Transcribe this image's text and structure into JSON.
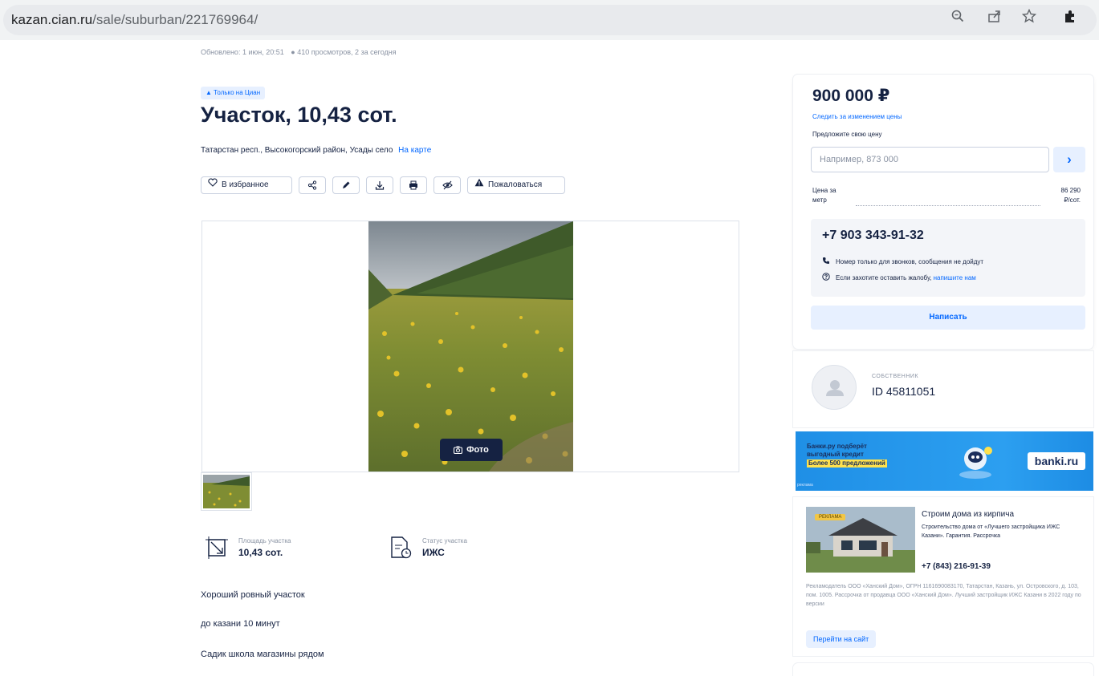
{
  "browser": {
    "url_domain": "kazan.cian.ru",
    "url_path": "/sale/suburban/221769964/",
    "icons": [
      "zoom-icon",
      "share-icon",
      "star-icon",
      "extensions-icon"
    ]
  },
  "meta": {
    "updated": "Обновлено: 1 июн, 20:51",
    "views": "410 просмотров, 2 за сегодня"
  },
  "listing": {
    "tag": "Только на Циан",
    "title": "Участок, 10,43 сот.",
    "address": "Татарстан респ., Высокогорский район, Усады село",
    "map_link": "На карте"
  },
  "actions": {
    "favorite": "В избранное",
    "complain": "Пожаловаться"
  },
  "gallery": {
    "photo_button": "Фото"
  },
  "features": [
    {
      "label": "Площадь участка",
      "value": "10,43 сот."
    },
    {
      "label": "Статус участка",
      "value": "ИЖС"
    }
  ],
  "description": [
    "Хороший ровный участок",
    "до казани 10 минут",
    "Садик школа магазины рядом"
  ],
  "price_card": {
    "price": "900 000 ₽",
    "track_link": "Следить за изменением цены",
    "offer_label": "Предложите свою цену",
    "offer_placeholder": "Например, 873 000",
    "ppm_label_1": "Цена за",
    "ppm_label_2": "метр",
    "ppm_value_1": "86 290",
    "ppm_value_2": "₽/сот.",
    "phone": "+7 903 343-91-32",
    "note_calls": "Номер только для звонков, сообщения не дойдут",
    "note_complaint": "Если захотите оставить жалобу,",
    "note_complaint_link": "напишите нам",
    "write_button": "Написать"
  },
  "owner": {
    "role": "СОБСТВЕННИК",
    "id": "ID 45811051"
  },
  "banner": {
    "line1": "Банки.ру подберёт",
    "line2": "выгодный кредит",
    "line3": "Более 500 предложений",
    "logo": "banki.ru",
    "tag": "реклама"
  },
  "ad": {
    "badge": "РЕКЛАМА",
    "title": "Строим дома из кирпича",
    "subtitle": "Строительство дома от «Лучшего застройщика ИЖС Казани». Гарантия. Рассрочка",
    "phone": "+7 (843) 216-91-39",
    "legal": "Рекламодатель ООО «Ханский Дом», ОГРН 1161690083170, Татарстан, Казань, ул. Островского, д. 103, пом. 1005. Рассрочка от продавца ООО «Ханский Дом». Лучший застройщик ИЖС Казани в 2022 году по версии",
    "link": "Перейти на сайт"
  }
}
